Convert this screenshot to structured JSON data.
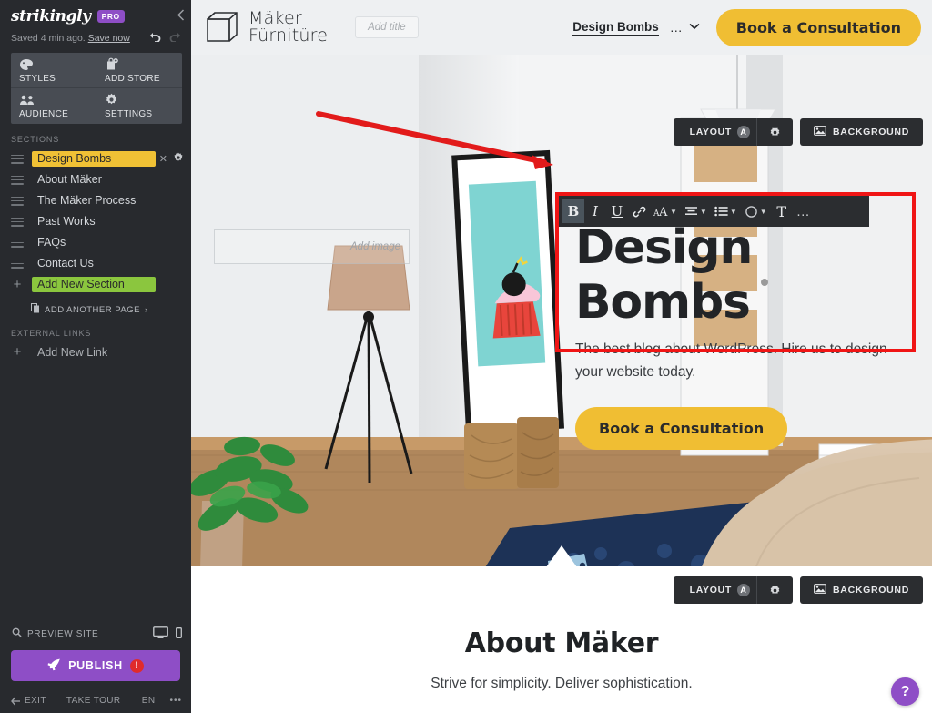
{
  "sidebar": {
    "brand": "strikingly",
    "pro_badge": "PRO",
    "save_status": "Saved 4 min ago.",
    "save_now": "Save now",
    "icons": {
      "collapse": "chevron-left-icon",
      "undo": "undo-icon",
      "redo": "redo-icon"
    },
    "quick_actions": [
      {
        "label": "STYLES",
        "icon": "palette-icon"
      },
      {
        "label": "ADD STORE",
        "icon": "store-bag-plus-icon"
      },
      {
        "label": "AUDIENCE",
        "icon": "people-icon"
      },
      {
        "label": "SETTINGS",
        "icon": "gear-icon"
      }
    ],
    "sections_header": "SECTIONS",
    "sections": [
      {
        "label": "Design Bombs",
        "active": true
      },
      {
        "label": "About Mäker",
        "active": false
      },
      {
        "label": "The Mäker Process",
        "active": false
      },
      {
        "label": "Past Works",
        "active": false
      },
      {
        "label": "FAQs",
        "active": false
      },
      {
        "label": "Contact Us",
        "active": false
      }
    ],
    "add_new_section": "Add New Section",
    "add_another_page": "ADD ANOTHER PAGE",
    "add_another_page_caret": "›",
    "external_links_header": "EXTERNAL LINKS",
    "add_new_link": "Add New Link",
    "preview_site": "PREVIEW SITE",
    "publish": "PUBLISH",
    "publish_warning": "!",
    "footer": {
      "exit": "EXIT",
      "take_tour": "TAKE TOUR",
      "language": "EN",
      "more": "•••"
    }
  },
  "site": {
    "logo_line1": "Mäker",
    "logo_line2": "Fürnitüre",
    "add_title_placeholder": "Add title",
    "nav_link": "Design Bombs",
    "nav_more_dots": "…",
    "nav_caret": "⌄",
    "nav_cta": "Book a Consultation"
  },
  "section_controls": {
    "layout_label": "LAYOUT",
    "layout_badge": "A",
    "background_label": "BACKGROUND",
    "gear_icon": "gear-icon",
    "background_icon": "image-icon"
  },
  "text_toolbar": {
    "items": [
      {
        "name": "bold",
        "glyph": "B",
        "active": true,
        "caret": false
      },
      {
        "name": "italic",
        "glyph": "I",
        "active": false,
        "caret": false
      },
      {
        "name": "underline",
        "glyph": "U",
        "active": false,
        "caret": false
      },
      {
        "name": "link",
        "glyph": "link-icon",
        "active": false,
        "caret": false
      },
      {
        "name": "font",
        "glyph": "font-style-icon",
        "active": false,
        "caret": true
      },
      {
        "name": "align",
        "glyph": "align-center-icon",
        "active": false,
        "caret": true
      },
      {
        "name": "list",
        "glyph": "bullet-list-icon",
        "active": false,
        "caret": true
      },
      {
        "name": "color",
        "glyph": "color-circle-icon",
        "active": false,
        "caret": true
      },
      {
        "name": "text-size",
        "glyph": "T",
        "active": false,
        "caret": false
      },
      {
        "name": "more",
        "glyph": "…",
        "active": false,
        "caret": false
      }
    ]
  },
  "hero": {
    "add_image_placeholder": "Add image",
    "heading_line1": "Design",
    "heading_line2": "Bombs",
    "subtitle": "The best blog about WordPress. Hire us to design your website today.",
    "cta": "Book a Consultation"
  },
  "about": {
    "heading": "About Mäker",
    "subtitle": "Strive for simplicity. Deliver sophistication.",
    "layout_label": "LAYOUT",
    "layout_badge": "A",
    "background_label": "BACKGROUND"
  },
  "help": {
    "label": "?"
  },
  "colors": {
    "sidebar_bg": "#282a2e",
    "accent_yellow": "#f0be33",
    "section_active": "#f0c135",
    "add_section_green": "#8bc63e",
    "publish_purple": "#8e4ec6",
    "annotation_red": "#f01515",
    "toolbar_dark": "#2b2d30"
  }
}
